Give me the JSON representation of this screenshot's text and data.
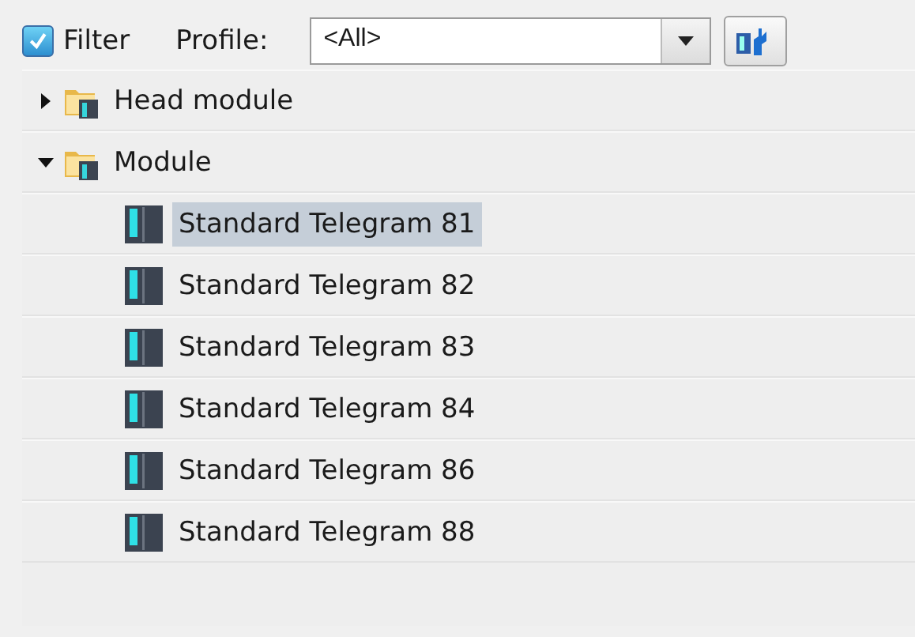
{
  "filter": {
    "label": "Filter",
    "checked": true
  },
  "profile": {
    "label": "Profile:",
    "value": "<All>"
  },
  "tree": [
    {
      "label": "Head module",
      "kind": "folder",
      "expanded": false,
      "selected": false
    },
    {
      "label": "Module",
      "kind": "folder",
      "expanded": true,
      "selected": false,
      "children": [
        {
          "label": "Standard Telegram 81",
          "kind": "module",
          "selected": true
        },
        {
          "label": "Standard Telegram 82",
          "kind": "module",
          "selected": false
        },
        {
          "label": "Standard Telegram 83",
          "kind": "module",
          "selected": false
        },
        {
          "label": "Standard Telegram 84",
          "kind": "module",
          "selected": false
        },
        {
          "label": "Standard Telegram 86",
          "kind": "module",
          "selected": false
        },
        {
          "label": "Standard Telegram 88",
          "kind": "module",
          "selected": false
        }
      ]
    }
  ]
}
